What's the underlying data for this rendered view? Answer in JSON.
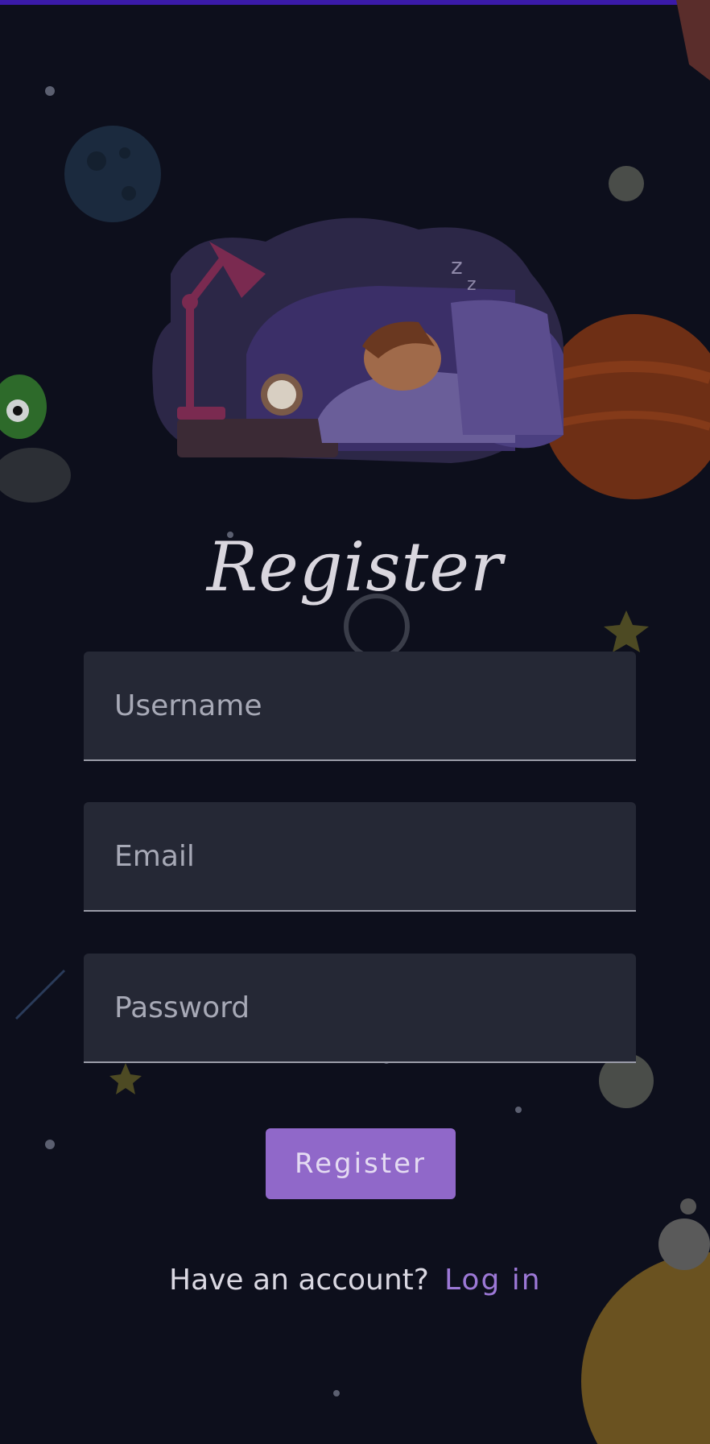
{
  "title": "Register",
  "fields": {
    "username": {
      "placeholder": "Username"
    },
    "email": {
      "placeholder": "Email"
    },
    "password": {
      "placeholder": "Password"
    }
  },
  "register_button": "Register",
  "footer": {
    "prompt": "Have an account?",
    "login_link": "Log in"
  },
  "colors": {
    "accent": "#9068c9",
    "background": "#0d0f1c",
    "link": "#9c78d6"
  }
}
